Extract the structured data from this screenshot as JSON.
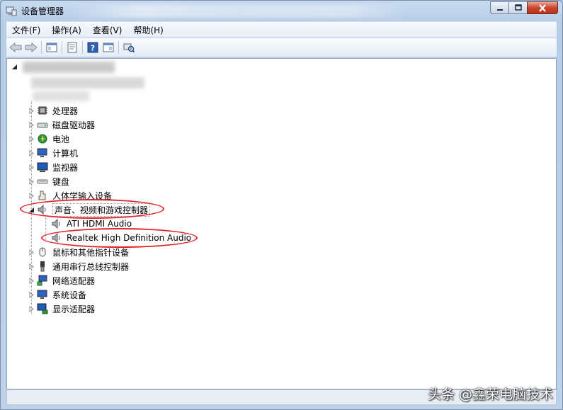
{
  "window": {
    "title": "设备管理器"
  },
  "menu": [
    {
      "label": "文件(F)"
    },
    {
      "label": "操作(A)"
    },
    {
      "label": "查看(V)"
    },
    {
      "label": "帮助(H)"
    }
  ],
  "toolbar": {
    "buttons": [
      "back-arrow-icon",
      "forward-arrow-icon",
      "console-tree-icon",
      "properties-icon",
      "help-icon",
      "view-icon",
      "scan-hardware-icon"
    ]
  },
  "tree": {
    "categories": [
      {
        "label": "处理器",
        "icon": "cpu-icon"
      },
      {
        "label": "磁盘驱动器",
        "icon": "disk-drive-icon"
      },
      {
        "label": "电池",
        "icon": "battery-icon"
      },
      {
        "label": "计算机",
        "icon": "computer-icon"
      },
      {
        "label": "监视器",
        "icon": "monitor-icon"
      },
      {
        "label": "键盘",
        "icon": "keyboard-icon"
      },
      {
        "label": "人体学输入设备",
        "icon": "hid-icon"
      },
      {
        "label": "声音、视频和游戏控制器",
        "icon": "speaker-icon",
        "expanded": true,
        "children": [
          {
            "label": "ATI HDMI Audio",
            "icon": "speaker-icon"
          },
          {
            "label": "Realtek High Definition Audio",
            "icon": "speaker-icon"
          }
        ]
      },
      {
        "label": "鼠标和其他指针设备",
        "icon": "mouse-icon"
      },
      {
        "label": "通用串行总线控制器",
        "icon": "usb-icon"
      },
      {
        "label": "网络适配器",
        "icon": "network-adapter-icon"
      },
      {
        "label": "系统设备",
        "icon": "system-device-icon"
      },
      {
        "label": "显示适配器",
        "icon": "display-adapter-icon"
      }
    ]
  },
  "watermark": "头条 @鑫荣电脑技术",
  "colors": {
    "annotation_circle": "#e3242b",
    "window_frame": "#b6cde8"
  }
}
